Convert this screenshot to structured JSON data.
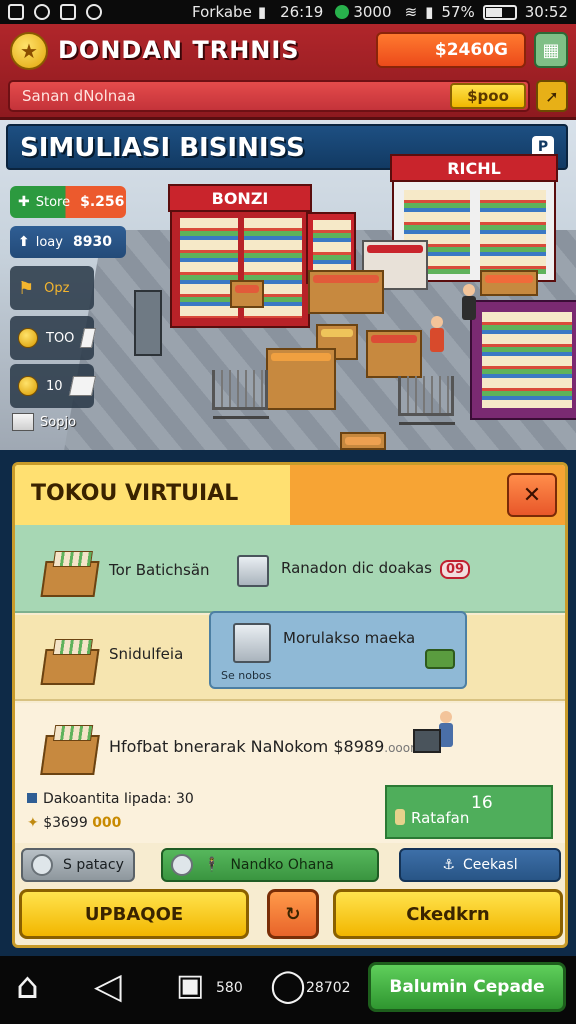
{
  "status_bar": {
    "left_text": "Forkabe",
    "time_center": "26:19",
    "network": "3000",
    "battery_pct": "57%",
    "clock": "30:52"
  },
  "header": {
    "title": "DONDAN TRHNIS",
    "money": "$2460G",
    "sub_label": "Sanan dNolnaa",
    "sub_value": "$poo"
  },
  "scene": {
    "title": "SIMULIASI BISINISS",
    "store_sign_left": "BONZI",
    "store_sign_right": "RICHL",
    "stats": {
      "store_label": "Store",
      "store_value": "$.256",
      "today_label": "loay",
      "today_value": "8930",
      "item1_label": "Opz",
      "item2_label": "TOO",
      "item3_label": "10",
      "stock_label": "Sopjo"
    }
  },
  "panel": {
    "title": "TOKOU VIRTUIAL",
    "close_glyph": "✕",
    "row1": {
      "left_label": "Tor Batichsän",
      "right_label": "Ranadon dic doakas",
      "badge": "09"
    },
    "row2": {
      "left_label": "Snidulfeia",
      "card_title": "Morulakso maeka",
      "card_sub": "Se nobos"
    },
    "row3": {
      "headline": "Hfofbat bnerarak NaNokom $8989",
      "headline_suffix": ".ooom",
      "line1": "Dakoantita Iipada: 30",
      "line2_a": "$3699",
      "line2_b": "000",
      "rat_label": "Ratafan",
      "rat_value": "16"
    },
    "pills": {
      "grey": "S patacy",
      "green": "Nandko Ohana",
      "blue": "Ceekasl"
    },
    "buttons": {
      "upgrade": "UPBAQOE",
      "mid_glyph": "↻",
      "checkout": "Ckedkrn"
    }
  },
  "bottom_nav": {
    "item2_count": "580",
    "item3_count": "28702",
    "balance_button": "Balumin Cepade"
  },
  "colors": {
    "header_red": "#b1262b",
    "panel_bg": "#f7ecd0",
    "accent_yellow": "#f2b600",
    "accent_green": "#3a9540",
    "accent_blue": "#285586"
  }
}
